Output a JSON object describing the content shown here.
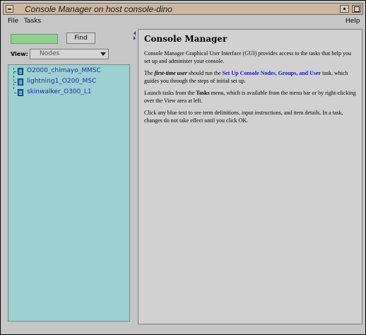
{
  "window": {
    "title": "Console Manager on host console-dino"
  },
  "menubar": {
    "file": "File",
    "tasks": "Tasks",
    "help": "Help"
  },
  "find": {
    "input_value": "",
    "button_label": "Find"
  },
  "view": {
    "label": "View:",
    "selected": "Nodes"
  },
  "tree": {
    "items": [
      {
        "label": "O2000_chimayo_MMSC"
      },
      {
        "label": "lightning1_O200_MSC"
      },
      {
        "label": "skinwalker_O300_L1"
      }
    ]
  },
  "help": {
    "title": "Console Manager",
    "p1": "Console Manager Graphical User Interface (GUI) provides access to the tasks that help you set up and administer your console.",
    "p2_pre": "The ",
    "p2_em": "first-time user",
    "p2_mid": " should run the ",
    "p2_link": "Set Up Console Nodes, Groups, and User",
    "p2_post": " task, which guides you through the steps of initial set up.",
    "p3_pre": "Launch tasks from the ",
    "p3_bold": "Tasks",
    "p3_post": " menu, which is available from the menu bar or by right-clicking over the View area at left.",
    "p4": "Click any blue text to see term definitions, input instructions, and item details. In a task, changes do not take effect until you click OK."
  },
  "colors": {
    "titlebar": "#ccb8a2",
    "tree_bg": "#9dd0d0",
    "link": "#1515c8",
    "find_input": "#8fd08f"
  }
}
